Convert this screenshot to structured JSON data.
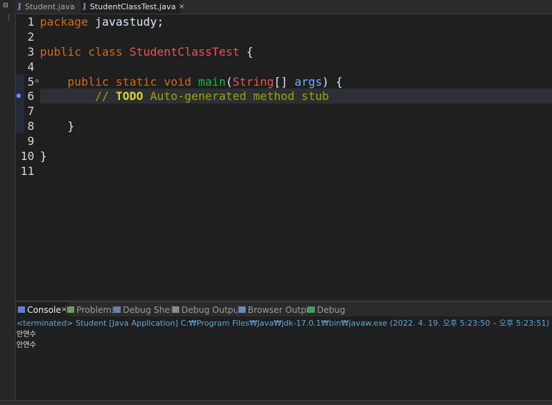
{
  "tabs": [
    {
      "label": "Student.java",
      "active": false
    },
    {
      "label": "StudentClassTest.java",
      "active": true
    }
  ],
  "tab_close_glyph": "×",
  "left_glyphs": [
    "⊟",
    "⋮"
  ],
  "code_lines": [
    {
      "n": "1",
      "parts": [
        [
          "kw",
          "package"
        ],
        [
          "txt",
          " javastudy;"
        ]
      ]
    },
    {
      "n": "2",
      "parts": []
    },
    {
      "n": "3",
      "parts": [
        [
          "kw",
          "public"
        ],
        [
          "txt",
          " "
        ],
        [
          "kw",
          "class"
        ],
        [
          "txt",
          " "
        ],
        [
          "cls",
          "StudentClassTest"
        ],
        [
          "txt",
          " {"
        ]
      ]
    },
    {
      "n": "4",
      "parts": []
    },
    {
      "n": "5",
      "parts": [
        [
          "txt",
          "    "
        ],
        [
          "kw",
          "public"
        ],
        [
          "txt",
          " "
        ],
        [
          "kw",
          "static"
        ],
        [
          "txt",
          " "
        ],
        [
          "kw",
          "void"
        ],
        [
          "txt",
          " "
        ],
        [
          "mtd",
          "main"
        ],
        [
          "txt",
          "("
        ],
        [
          "type",
          "String"
        ],
        [
          "txt",
          "[] "
        ],
        [
          "prm",
          "args"
        ],
        [
          "txt",
          ") {"
        ]
      ]
    },
    {
      "n": "6",
      "parts": [
        [
          "txt",
          "        "
        ],
        [
          "cmt",
          "// "
        ],
        [
          "todo",
          "TODO"
        ],
        [
          "cmt",
          " Auto-generated method stub"
        ]
      ]
    },
    {
      "n": "7",
      "parts": []
    },
    {
      "n": "8",
      "parts": [
        [
          "txt",
          "    }"
        ]
      ]
    },
    {
      "n": "9",
      "parts": []
    },
    {
      "n": "10",
      "parts": [
        [
          "txt",
          "}"
        ]
      ]
    },
    {
      "n": "11",
      "parts": []
    }
  ],
  "current_line": "6",
  "console": {
    "tabs": [
      {
        "label": "Console",
        "active": true,
        "icon": "console-icon"
      },
      {
        "label": "Problems",
        "active": false,
        "icon": "problems-icon"
      },
      {
        "label": "Debug Shell",
        "active": false,
        "icon": "debug-shell-icon"
      },
      {
        "label": "Debug Output",
        "active": false,
        "icon": "debug-output-icon"
      },
      {
        "label": "Browser Output",
        "active": false,
        "icon": "browser-output-icon"
      },
      {
        "label": "Debug",
        "active": false,
        "icon": "debug-icon"
      }
    ],
    "terminated_line": "<terminated> Student [Java Application] C:₩Program Files₩Java₩jdk-17.0.1₩bin₩javaw.exe  (2022. 4. 19. 오후 5:23:50 – 오후 5:23:51)",
    "output": [
      "안연수",
      "안연수"
    ]
  },
  "colors": {
    "editor_bg": "#1f1f1f",
    "keyword": "#cc6c1d",
    "class_name": "#e6574d",
    "method": "#1eb540",
    "param": "#79abff",
    "comment": "#a4a200",
    "console_link": "#5fa7d9"
  }
}
